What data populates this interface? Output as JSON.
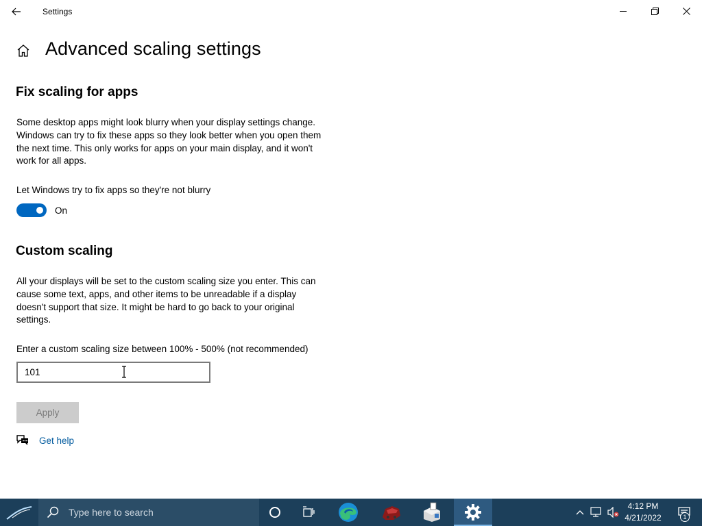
{
  "window": {
    "title": "Settings"
  },
  "page": {
    "title": "Advanced scaling settings"
  },
  "fix_scaling": {
    "heading": "Fix scaling for apps",
    "description": "Some desktop apps might look blurry when your display settings change. Windows can try to fix these apps so they look better when you open them the next time. This only works for apps on your main display, and it won't work for all apps.",
    "toggle_label": "Let Windows try to fix apps so they're not blurry",
    "toggle_state": "On",
    "toggle_on": true
  },
  "custom_scaling": {
    "heading": "Custom scaling",
    "description": "All your displays will be set to the custom scaling size you enter. This can cause some text, apps, and other items to be unreadable if a display doesn't support that size. It might be hard to go back to your original settings.",
    "input_label": "Enter a custom scaling size between 100% - 500% (not recommended)",
    "input_value": "101",
    "apply_label": "Apply"
  },
  "help": {
    "label": "Get help"
  },
  "taskbar": {
    "search_placeholder": "Type here to search",
    "time": "4:12 PM",
    "date": "4/21/2022",
    "notification_count": "1",
    "accent_color": "#1c3f5a",
    "pinned": [
      "cortana-icon",
      "task-view-icon",
      "edge-icon",
      "game-app-icon",
      "file-manager-icon",
      "settings-gear-icon"
    ]
  }
}
